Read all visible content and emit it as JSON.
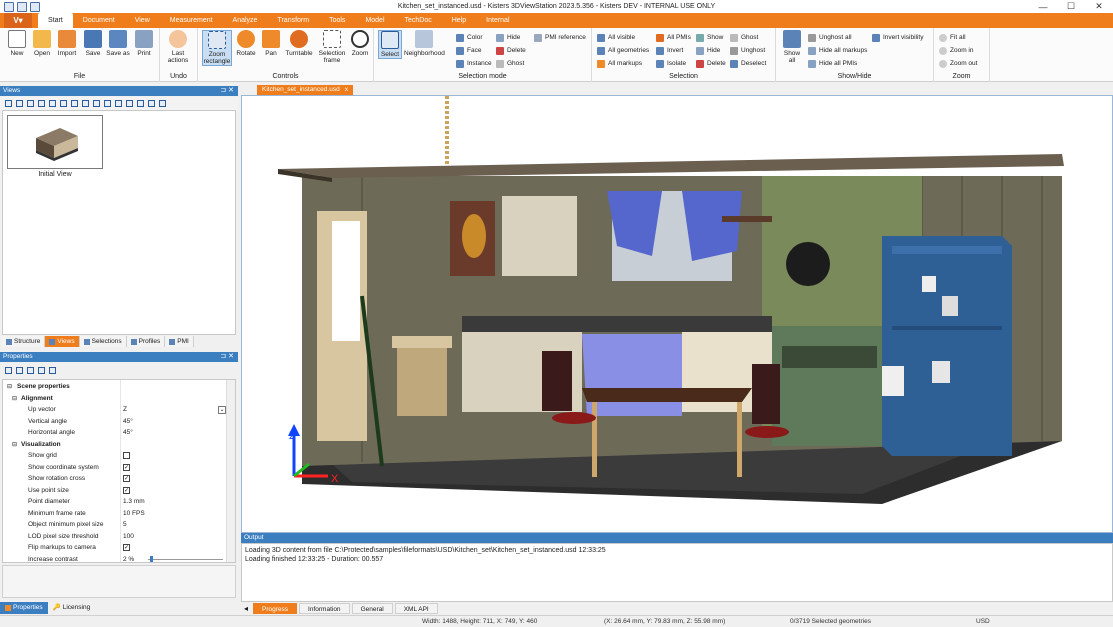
{
  "window": {
    "title": "Kitchen_set_instanced.usd - Kisters 3DViewStation 2023.5.356 - Kisters DEV - INTERNAL USE ONLY",
    "minimize": "—",
    "maximize": "☐",
    "close": "✕"
  },
  "menu": {
    "app_button": "V",
    "tabs": [
      "Start",
      "Document",
      "View",
      "Measurement",
      "Analyze",
      "Transform",
      "Tools",
      "Model",
      "TechDoc",
      "Help",
      "Internal"
    ]
  },
  "ribbon": {
    "file": {
      "label": "File",
      "new": "New",
      "open": "Open",
      "import": "Import",
      "save": "Save",
      "save_as": "Save as",
      "print": "Print"
    },
    "undo": {
      "label": "Undo",
      "last_actions": "Last actions"
    },
    "controls": {
      "label": "Controls",
      "zoom_rectangle": "Zoom rectangle",
      "rotate": "Rotate",
      "pan": "Pan",
      "turntable": "Turntable",
      "selection_frame": "Selection frame",
      "zoom": "Zoom"
    },
    "selection_mode": {
      "label": "Selection mode",
      "select": "Select",
      "neighborhood": "Neighborhood",
      "color": "Color",
      "face": "Face",
      "instance": "Instance",
      "hide": "Hide",
      "delete": "Delete",
      "ghost": "Ghost",
      "pmi_reference": "PMI reference"
    },
    "selection": {
      "label": "Selection",
      "all_visible": "All visible",
      "all_geometries": "All geometries",
      "all_markups": "All markups",
      "all_pmis": "All PMIs",
      "invert": "Invert",
      "isolate": "Isolate",
      "show": "Show",
      "hide": "Hide",
      "delete": "Delete",
      "ghost": "Ghost",
      "unghost": "Unghost",
      "deselect": "Deselect"
    },
    "show_hide": {
      "label": "Show/Hide",
      "show_all": "Show all",
      "unghost_all": "Unghost all",
      "hide_all_markups": "Hide all markups",
      "hide_all_pmis": "Hide all PMIs",
      "invert_visibility": "Invert visibility"
    },
    "zoom": {
      "label": "Zoom",
      "fit_all": "Fit all",
      "zoom_in": "Zoom in",
      "zoom_out": "Zoom out"
    }
  },
  "views_panel": {
    "title": "Views",
    "thumbnail_label": "Initial View",
    "tabs": [
      "Structure",
      "Views",
      "Selections",
      "Profiles",
      "PMI"
    ],
    "active_tab": "Views"
  },
  "properties_panel": {
    "title": "Properties",
    "rows": [
      {
        "kind": "cat",
        "name": "Scene properties",
        "toggle": "⊟"
      },
      {
        "kind": "cat",
        "name": "Alignment",
        "toggle": "⊟"
      },
      {
        "kind": "prop",
        "name": "Up vector",
        "value": "Z",
        "dropdown": true
      },
      {
        "kind": "prop",
        "name": "Vertical angle",
        "value": "45°"
      },
      {
        "kind": "prop",
        "name": "Horizontal angle",
        "value": "45°"
      },
      {
        "kind": "cat",
        "name": "Visualization",
        "toggle": "⊟"
      },
      {
        "kind": "prop",
        "name": "Show grid",
        "check": false
      },
      {
        "kind": "prop",
        "name": "Show coordinate system",
        "check": true
      },
      {
        "kind": "prop",
        "name": "Show rotation cross",
        "check": true
      },
      {
        "kind": "prop",
        "name": "Use point size",
        "check": true
      },
      {
        "kind": "prop",
        "name": "Point diameter",
        "value": "1.3 mm"
      },
      {
        "kind": "prop",
        "name": "Minimum frame rate",
        "value": "10 FPS"
      },
      {
        "kind": "prop",
        "name": "Object minimum pixel size",
        "value": "5"
      },
      {
        "kind": "prop",
        "name": "LOD pixel size threshold",
        "value": "100"
      },
      {
        "kind": "prop",
        "name": "Flip markups to camera",
        "check": true
      },
      {
        "kind": "prop",
        "name": "Increase contrast",
        "value": "2 %",
        "slider": 0.02
      }
    ]
  },
  "left_bottom_tabs": [
    "Properties",
    "Licensing"
  ],
  "document": {
    "tab": "Kitchen_set_instanced.usd",
    "tab_close": "x"
  },
  "output": {
    "title": "Output",
    "lines": [
      "Loading 3D content from file C:\\Protected\\samples\\fileformats\\USD\\Kitchen_set\\Kitchen_set_instanced.usd 12:33:25",
      "Loading finished 12:33:25 - Duration: 00.557"
    ],
    "tabs": [
      "Progress",
      "Information",
      "General",
      "XML API"
    ],
    "active_tab": "Progress"
  },
  "viewport": {
    "axis_x": "X",
    "axis_z": "Z"
  },
  "status": {
    "size": "Width: 1488, Height: 711, X: 749, Y: 460",
    "coords": "(X: 26.64 mm, Y: 79.83 mm, Z: 55.98 mm)",
    "selected": "0/3719 Selected geometries",
    "unit": "USD"
  },
  "colors": {
    "accent": "#f07d1b",
    "panel_header": "#3c7fc1"
  }
}
